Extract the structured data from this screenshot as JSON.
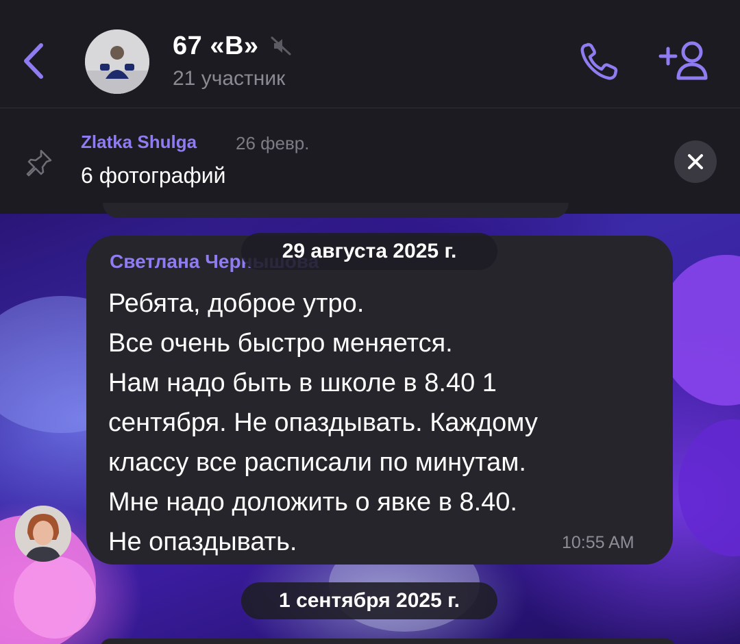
{
  "header": {
    "title": "67 «В»",
    "subtitle": "21 участник"
  },
  "pinned": {
    "author": "Zlatka Shulga",
    "date": "26 февр.",
    "text": "6 фотографий"
  },
  "messages": [
    {
      "sender": "Светлана Чернышова",
      "lines": [
        "Ребята, доброе утро.",
        "Все очень быстро меняется.",
        "Нам надо быть в школе в 8.40 1",
        "сентября.  Не опаздывать. Каждому",
        "классу все расписали по минутам.",
        "Мне надо доложить о явке в 8.40.",
        "Не опаздывать."
      ],
      "time": "10:55 AM"
    }
  ],
  "date_separators": [
    "29 августа 2025 г.",
    "1 сентября 2025 г."
  ],
  "colors": {
    "accent": "#8f7cf0",
    "background": "#1c1b21",
    "bubble": "#26252b",
    "muted_text": "#8b8a93"
  },
  "icons": {
    "back": "chevron-left-icon",
    "mute": "muted-speaker-icon",
    "call": "phone-icon",
    "add_member": "add-person-icon",
    "pin": "pin-icon",
    "close": "close-icon"
  }
}
